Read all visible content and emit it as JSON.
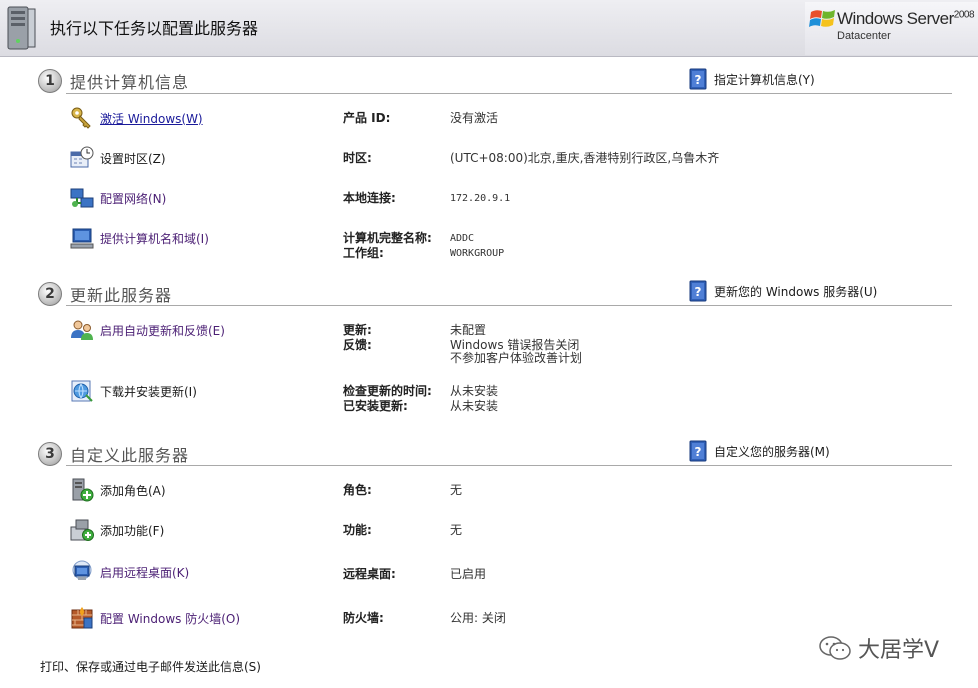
{
  "header": {
    "title": "执行以下任务以配置此服务器",
    "brand_line1": "Windows Server",
    "brand_version": "2008",
    "brand_line2": "Datacenter"
  },
  "sections": [
    {
      "number": "1",
      "title": "提供计算机信息",
      "help_link": "指定计算机信息(Y)",
      "tasks": [
        {
          "label": "激活 Windows(W)",
          "icon": "key-icon",
          "props": [
            {
              "k": "产品 ID:",
              "v": [
                "没有激活"
              ]
            }
          ]
        },
        {
          "label": "设置时区(Z)",
          "icon": "calendar-clock-icon",
          "props": [
            {
              "k": "时区:",
              "v": [
                "(UTC+08:00)北京,重庆,香港特别行政区,乌鲁木齐"
              ]
            }
          ]
        },
        {
          "label": "配置网络(N)",
          "icon": "network-icon",
          "props": [
            {
              "k": "本地连接:",
              "v": [
                "172.20.9.1"
              ]
            }
          ]
        },
        {
          "label": "提供计算机名和域(I)",
          "icon": "computer-icon",
          "props": [
            {
              "k": "计算机完整名称:",
              "v": [
                "ADDC"
              ]
            },
            {
              "k": "工作组:",
              "v": [
                "WORKGROUP"
              ]
            }
          ]
        }
      ]
    },
    {
      "number": "2",
      "title": "更新此服务器",
      "help_link": "更新您的 Windows 服务器(U)",
      "tasks": [
        {
          "label": "启用自动更新和反馈(E)",
          "icon": "users-update-icon",
          "props": [
            {
              "k": "更新:",
              "v": [
                "未配置"
              ]
            },
            {
              "k": "反馈:",
              "v": [
                "Windows 错误报告关闭",
                "不参加客户体验改善计划"
              ]
            }
          ]
        },
        {
          "label": "下载并安装更新(I)",
          "icon": "globe-update-icon",
          "props": [
            {
              "k": "检查更新的时间:",
              "v": [
                "从未安装"
              ]
            },
            {
              "k": "已安装更新:",
              "v": [
                "从未安装"
              ]
            }
          ]
        }
      ]
    },
    {
      "number": "3",
      "title": "自定义此服务器",
      "help_link": "自定义您的服务器(M)",
      "tasks": [
        {
          "label": "添加角色(A)",
          "icon": "add-role-icon",
          "props": [
            {
              "k": "角色:",
              "v": [
                "无"
              ]
            }
          ]
        },
        {
          "label": "添加功能(F)",
          "icon": "add-feature-icon",
          "props": [
            {
              "k": "功能:",
              "v": [
                "无"
              ]
            }
          ]
        },
        {
          "label": "启用远程桌面(K)",
          "icon": "remote-desktop-icon",
          "props": [
            {
              "k": "远程桌面:",
              "v": [
                "已启用"
              ]
            }
          ]
        },
        {
          "label": "配置 Windows 防火墙(O)",
          "icon": "firewall-icon",
          "props": [
            {
              "k": "防火墙:",
              "v": [
                "公用: 关闭"
              ]
            }
          ]
        }
      ]
    }
  ],
  "footer_link": "打印、保存或通过电子邮件发送此信息(S)",
  "watermark": "大居学V"
}
